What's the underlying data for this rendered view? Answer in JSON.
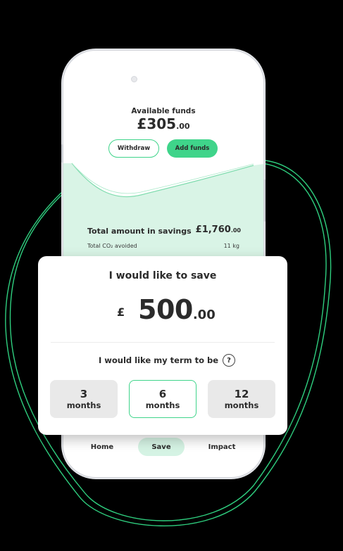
{
  "colors": {
    "accent": "#3fd48a",
    "accent_light": "#d5f3e4",
    "chart_fill": "#d9f4e6"
  },
  "funds": {
    "label": "Available funds",
    "amount_main": "£305",
    "amount_dec": ".00"
  },
  "buttons": {
    "withdraw": "Withdraw",
    "add_funds": "Add funds"
  },
  "savings": {
    "label": "Total amount in savings",
    "amount_main": "£1,760",
    "amount_dec": ".00",
    "co2_label": "Total CO₂ avoided",
    "co2_value": "11 kg"
  },
  "nav": {
    "home": "Home",
    "save": "Save",
    "impact": "Impact"
  },
  "save_card": {
    "title": "I would like to save",
    "currency": "£",
    "amount_main": "500",
    "amount_dec": ".00",
    "term_label": "I would like my term to be",
    "help_icon": "?",
    "terms": [
      {
        "num": "3",
        "unit": "months",
        "selected": false
      },
      {
        "num": "6",
        "unit": "months",
        "selected": true
      },
      {
        "num": "12",
        "unit": "months",
        "selected": false
      }
    ]
  }
}
